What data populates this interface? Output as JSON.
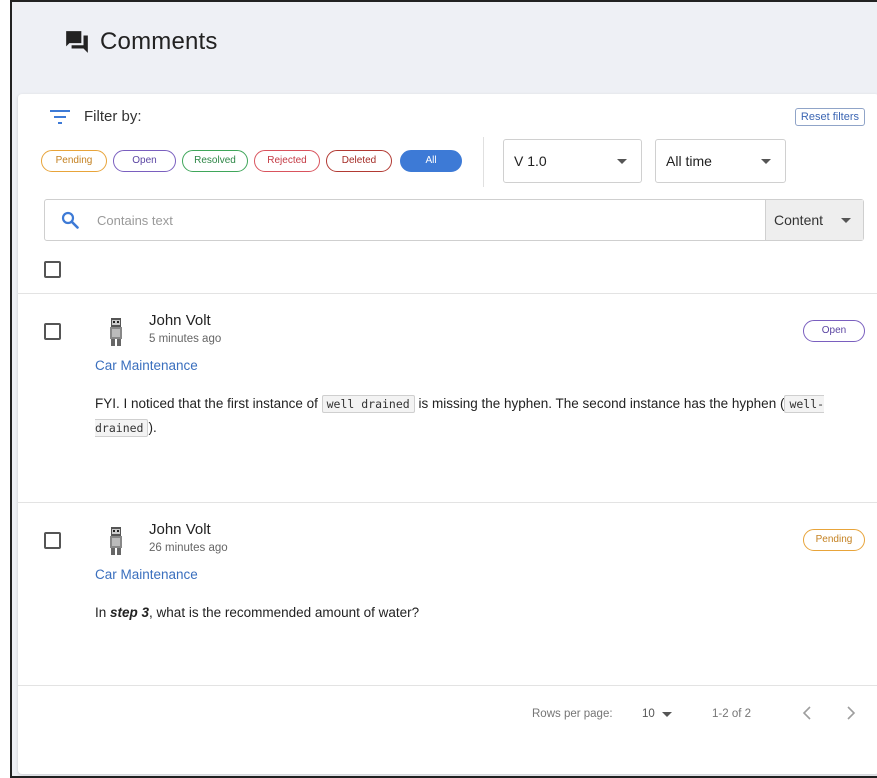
{
  "header": {
    "title": "Comments",
    "icon": "comments-icon"
  },
  "filters": {
    "label": "Filter by:",
    "reset_label": "Reset filters",
    "chips": [
      "Pending",
      "Open",
      "Resolved",
      "Rejected",
      "Deleted",
      "All"
    ],
    "version": "V 1.0",
    "timespan": "All time"
  },
  "search": {
    "placeholder": "Contains text",
    "scope": "Content"
  },
  "comments": [
    {
      "author": "John Volt",
      "time": "5 minutes ago",
      "document": "Car Maintenance",
      "status": "Open",
      "text_a": "FYI. I noticed that the first instance of ",
      "code_a": "well drained",
      "text_b": " is missing the hyphen. The second instance has the hyphen (",
      "code_b": "well-drained",
      "text_c": ")."
    },
    {
      "author": "John Volt",
      "time": "26 minutes ago",
      "document": "Car Maintenance",
      "status": "Pending",
      "text_a": "In ",
      "emph": "step 3",
      "text_b": ", what is the recommended amount of water?"
    }
  ],
  "pagination": {
    "rows_label": "Rows per page:",
    "rows_value": "10",
    "range": "1-2 of 2"
  },
  "colors": {
    "accent": "#3d7ad6",
    "link": "#3a6fbe",
    "background": "#eef0f5"
  }
}
